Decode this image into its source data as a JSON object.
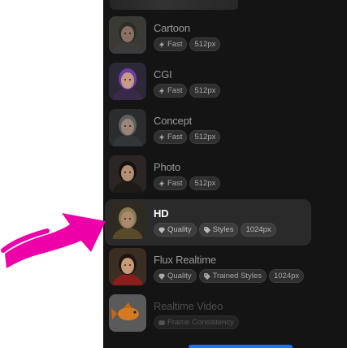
{
  "models": [
    {
      "name": "Cartoon",
      "thumb": "cartoon",
      "tags": [
        {
          "icon": "bolt-icon",
          "label": "Fast"
        },
        {
          "icon": "",
          "label": "512px"
        }
      ]
    },
    {
      "name": "CGI",
      "thumb": "cgi",
      "tags": [
        {
          "icon": "bolt-icon",
          "label": "Fast"
        },
        {
          "icon": "",
          "label": "512px"
        }
      ]
    },
    {
      "name": "Concept",
      "thumb": "concept",
      "tags": [
        {
          "icon": "bolt-icon",
          "label": "Fast"
        },
        {
          "icon": "",
          "label": "512px"
        }
      ]
    },
    {
      "name": "Photo",
      "thumb": "photo",
      "tags": [
        {
          "icon": "bolt-icon",
          "label": "Fast"
        },
        {
          "icon": "",
          "label": "512px"
        }
      ]
    },
    {
      "name": "HD",
      "thumb": "hd",
      "selected": true,
      "tags": [
        {
          "icon": "diamond-icon",
          "label": "Quality"
        },
        {
          "icon": "tag-icon",
          "label": "Styles"
        },
        {
          "icon": "",
          "label": "1024px"
        }
      ]
    },
    {
      "name": "Flux Realtime",
      "thumb": "flux",
      "tags": [
        {
          "icon": "diamond-icon",
          "label": "Quality"
        },
        {
          "icon": "tag-icon",
          "label": "Trained Styles"
        },
        {
          "icon": "",
          "label": "1024px"
        }
      ]
    },
    {
      "name": "Realtime Video",
      "thumb": "video",
      "dim": true,
      "tags": [
        {
          "icon": "film-icon",
          "label": "Frame Consistency"
        }
      ]
    }
  ],
  "colors": {
    "panel_bg": "#141414",
    "selected_bg": "#2a2a2a",
    "annotation_arrow": "#ee00a8",
    "accent_bar": "#1f6fff"
  }
}
